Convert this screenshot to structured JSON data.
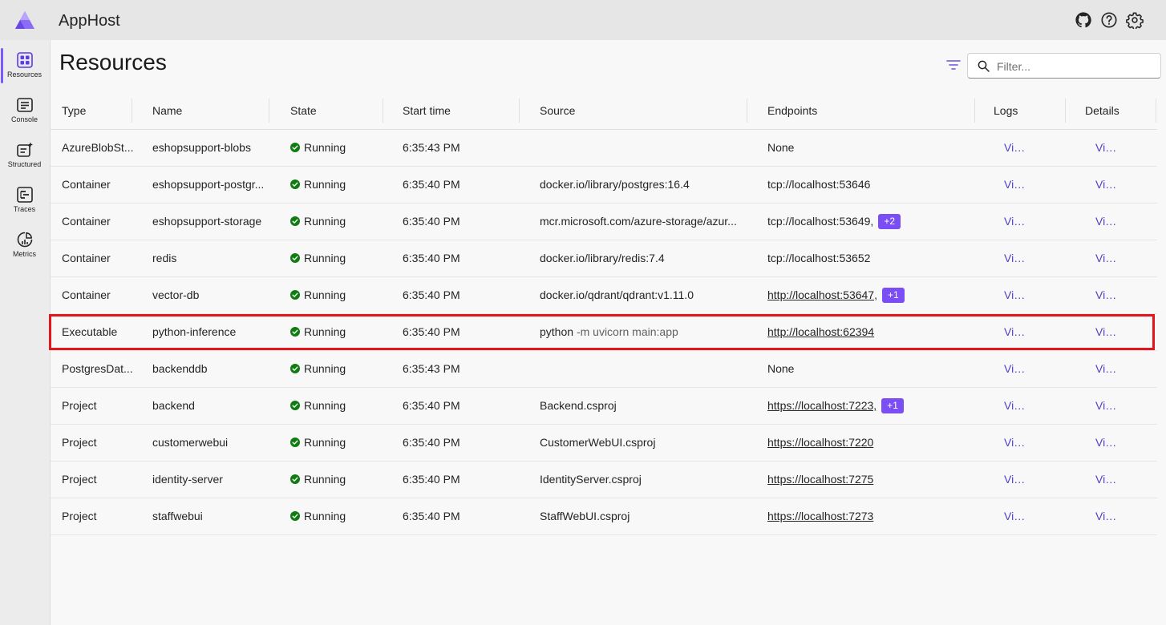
{
  "app": {
    "title": "AppHost"
  },
  "sidebar": {
    "items": [
      {
        "label": "Resources",
        "icon": "resources-icon",
        "active": true
      },
      {
        "label": "Console",
        "icon": "console-icon",
        "active": false
      },
      {
        "label": "Structured",
        "icon": "structured-logs-icon",
        "active": false
      },
      {
        "label": "Traces",
        "icon": "traces-icon",
        "active": false
      },
      {
        "label": "Metrics",
        "icon": "metrics-icon",
        "active": false
      }
    ]
  },
  "topbar": {
    "icons": [
      "github-icon",
      "help-icon",
      "settings-icon"
    ]
  },
  "page": {
    "title": "Resources"
  },
  "search": {
    "placeholder": "Filter...",
    "value": ""
  },
  "colors": {
    "accent": "#7b4ef5",
    "running": "#107c10",
    "link": "#4f42c9",
    "highlight": "#e3141b"
  },
  "table": {
    "headers": {
      "type": "Type",
      "name": "Name",
      "state": "State",
      "start": "Start time",
      "source": "Source",
      "endpoints": "Endpoints",
      "logs": "Logs",
      "details": "Details"
    },
    "rows": [
      {
        "type": "AzureBlobSt...",
        "name": "eshopsupport-blobs",
        "state": "Running",
        "start": "6:35:43 PM",
        "source": "",
        "source_args": "",
        "endpoint": "None",
        "endpoint_link": false,
        "extra": "",
        "logs": "View",
        "details": "View"
      },
      {
        "type": "Container",
        "name": "eshopsupport-postgr...",
        "state": "Running",
        "start": "6:35:40 PM",
        "source": "docker.io/library/postgres:16.4",
        "source_args": "",
        "endpoint": "tcp://localhost:53646",
        "endpoint_link": false,
        "extra": "",
        "logs": "View",
        "details": "View"
      },
      {
        "type": "Container",
        "name": "eshopsupport-storage",
        "state": "Running",
        "start": "6:35:40 PM",
        "source": "mcr.microsoft.com/azure-storage/azur...",
        "source_args": "",
        "endpoint": "tcp://localhost:53649,",
        "endpoint_link": false,
        "extra": "+2",
        "logs": "View",
        "details": "View"
      },
      {
        "type": "Container",
        "name": "redis",
        "state": "Running",
        "start": "6:35:40 PM",
        "source": "docker.io/library/redis:7.4",
        "source_args": "",
        "endpoint": "tcp://localhost:53652",
        "endpoint_link": false,
        "extra": "",
        "logs": "View",
        "details": "View"
      },
      {
        "type": "Container",
        "name": "vector-db",
        "state": "Running",
        "start": "6:35:40 PM",
        "source": "docker.io/qdrant/qdrant:v1.11.0",
        "source_args": "",
        "endpoint": "http://localhost:53647,",
        "endpoint_link": true,
        "extra": "+1",
        "logs": "View",
        "details": "View"
      },
      {
        "type": "Executable",
        "name": "python-inference",
        "state": "Running",
        "start": "6:35:40 PM",
        "source": "python",
        "source_args": "-m uvicorn main:app",
        "endpoint": "http://localhost:62394",
        "endpoint_link": true,
        "extra": "",
        "logs": "View",
        "details": "View"
      },
      {
        "type": "PostgresDat...",
        "name": "backenddb",
        "state": "Running",
        "start": "6:35:43 PM",
        "source": "",
        "source_args": "",
        "endpoint": "None",
        "endpoint_link": false,
        "extra": "",
        "logs": "View",
        "details": "View"
      },
      {
        "type": "Project",
        "name": "backend",
        "state": "Running",
        "start": "6:35:40 PM",
        "source": "Backend.csproj",
        "source_args": "",
        "endpoint": "https://localhost:7223,",
        "endpoint_link": true,
        "extra": "+1",
        "logs": "View",
        "details": "View"
      },
      {
        "type": "Project",
        "name": "customerwebui",
        "state": "Running",
        "start": "6:35:40 PM",
        "source": "CustomerWebUI.csproj",
        "source_args": "",
        "endpoint": "https://localhost:7220",
        "endpoint_link": true,
        "extra": "",
        "logs": "View",
        "details": "View"
      },
      {
        "type": "Project",
        "name": "identity-server",
        "state": "Running",
        "start": "6:35:40 PM",
        "source": "IdentityServer.csproj",
        "source_args": "",
        "endpoint": "https://localhost:7275",
        "endpoint_link": true,
        "extra": "",
        "logs": "View",
        "details": "View"
      },
      {
        "type": "Project",
        "name": "staffwebui",
        "state": "Running",
        "start": "6:35:40 PM",
        "source": "StaffWebUI.csproj",
        "source_args": "",
        "endpoint": "https://localhost:7273",
        "endpoint_link": true,
        "extra": "",
        "logs": "View",
        "details": "View"
      }
    ]
  }
}
